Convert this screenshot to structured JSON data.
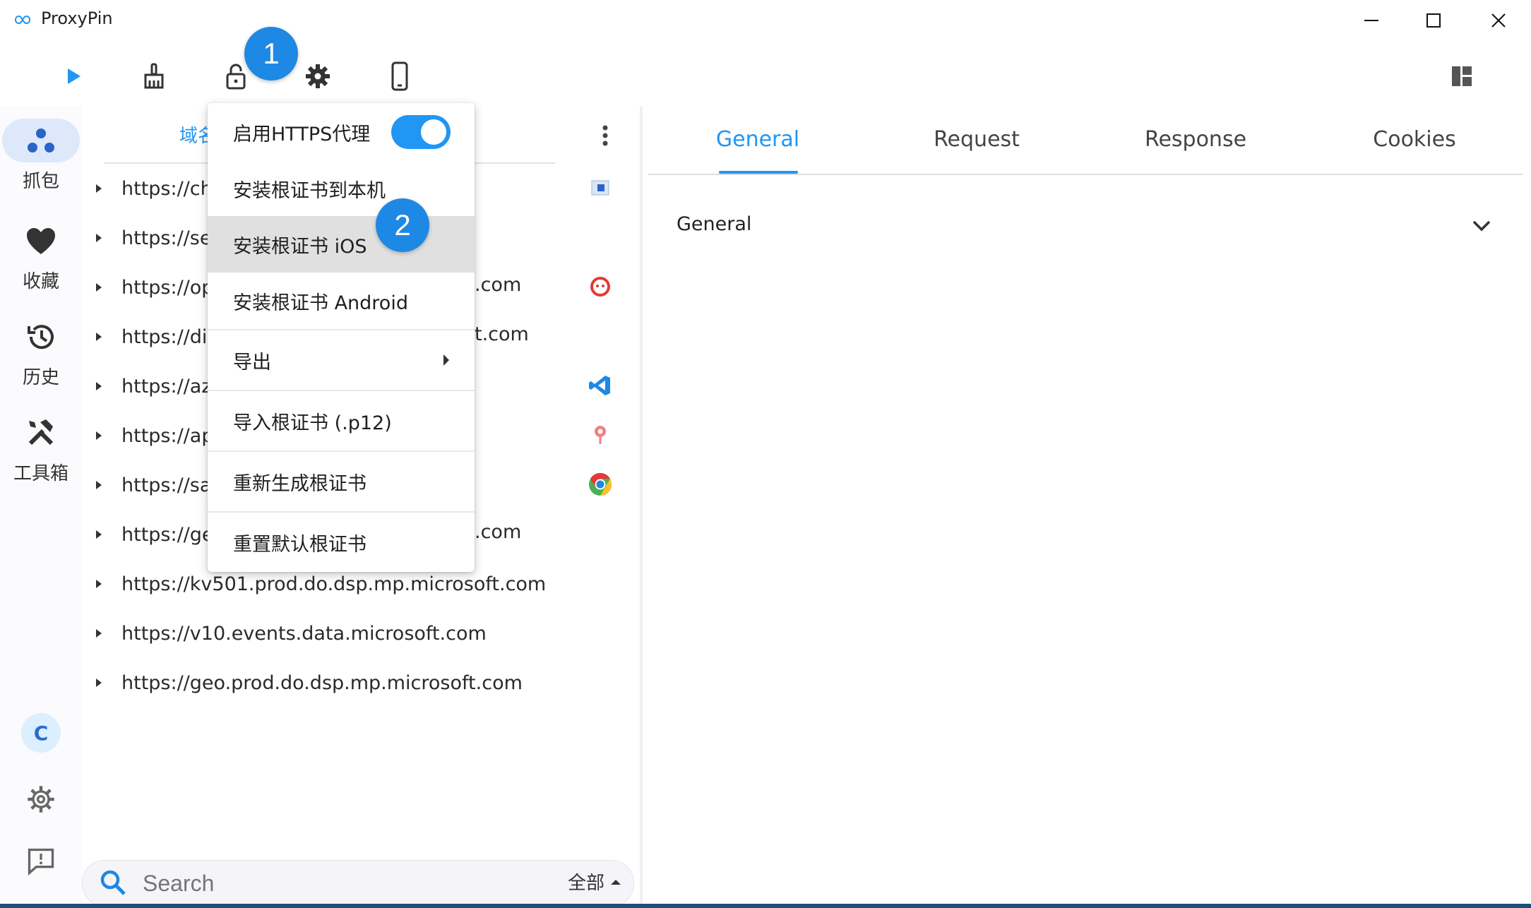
{
  "app": {
    "title": "ProxyPin"
  },
  "toolbar": {
    "start_icon": "play-icon",
    "clean_icon": "broom-icon",
    "https_icon": "lock-open-icon",
    "settings_icon": "gear-icon",
    "mobile_icon": "mobile-phone-icon",
    "layout_icon": "layout-icon"
  },
  "nav": {
    "items": [
      {
        "label": "抓包",
        "icon": "capture-dots-icon"
      },
      {
        "label": "收藏",
        "icon": "heart-icon"
      },
      {
        "label": "历史",
        "icon": "history-icon"
      },
      {
        "label": "工具箱",
        "icon": "tools-icon"
      }
    ],
    "avatar_letter": "C"
  },
  "list": {
    "tab_partial": "域名",
    "rows": [
      {
        "url": "https://ch",
        "icon": "app-square-icon"
      },
      {
        "url": "https://se",
        "icon": ""
      },
      {
        "url": "https://op",
        "tail": ".com",
        "icon": "red-circle-icon"
      },
      {
        "url": "https://dis",
        "tail": "t.com",
        "icon": ""
      },
      {
        "url": "https://az",
        "icon": "vscode-icon"
      },
      {
        "url": "https://ap",
        "icon": "pin-icon"
      },
      {
        "url": "https://sa",
        "icon": "chrome-icon"
      },
      {
        "url": "https://ge",
        "tail": ".com",
        "icon": ""
      },
      {
        "url": "https://kv501.prod.do.dsp.mp.microsoft.com",
        "icon": ""
      },
      {
        "url": "https://v10.events.data.microsoft.com",
        "icon": ""
      },
      {
        "url": "https://geo.prod.do.dsp.mp.microsoft.com",
        "icon": ""
      }
    ]
  },
  "menu": {
    "items": [
      {
        "label": "启用HTTPS代理",
        "toggle": true
      },
      {
        "label": "安装根证书到本机"
      },
      {
        "label": "安装根证书 iOS",
        "highlighted": true
      },
      {
        "label": "安装根证书 Android"
      },
      {
        "label": "导出",
        "submenu": true
      },
      {
        "label": "导入根证书 (.p12)"
      },
      {
        "label": "重新生成根证书"
      },
      {
        "label": "重置默认根证书"
      }
    ]
  },
  "detail": {
    "tabs": [
      "General",
      "Request",
      "Response",
      "Cookies"
    ],
    "active_tab": "General",
    "section_title": "General"
  },
  "search": {
    "placeholder": "Search",
    "filter_label": "全部"
  },
  "badges": {
    "one": "1",
    "two": "2"
  },
  "colors": {
    "accent": "#2196f3",
    "badge": "#1e88e5"
  }
}
